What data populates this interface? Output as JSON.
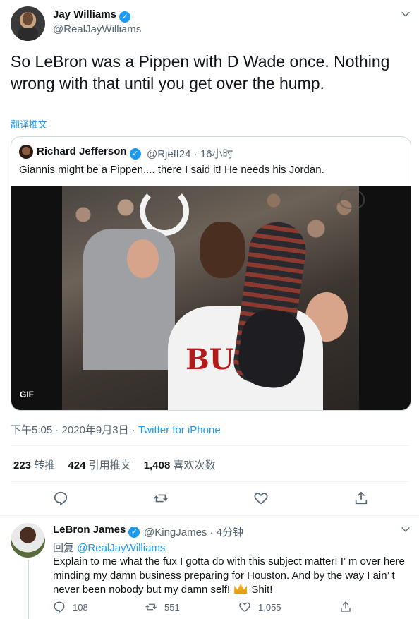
{
  "tweet": {
    "author_name": "Jay Williams",
    "author_handle": "@RealJayWilliams",
    "text": "So LeBron was a Pippen with D Wade once. Nothing wrong with that until you get over the hump.",
    "translate_label": "翻译推文",
    "time": "下午5:05",
    "date": "2020年9月3日",
    "separator": " · ",
    "source": "Twitter for iPhone",
    "stats": {
      "retweets_count": "223",
      "retweets_label": "转推",
      "quotes_count": "424",
      "quotes_label": "引用推文",
      "likes_count": "1,408",
      "likes_label": "喜欢次数"
    }
  },
  "quote": {
    "author_name": "Richard Jefferson",
    "author_handle": "@Rjeff24",
    "time_ago": "16小时",
    "text": "Giannis might be a Pippen.... there I said it! He needs his Jordan.",
    "media_badge": "GIF",
    "jersey_text": "BU"
  },
  "reply": {
    "author_name": "LeBron James",
    "author_handle": "@KingJames",
    "time_ago": "4分钟",
    "reply_prefix": "回复",
    "reply_mention": "@RealJayWilliams",
    "text_before_emoji": "Explain to me what the fux I gotta do with this subject matter! I’ m over here minding my damn business preparing for Houston. And by the way I ain’ t never been nobody but my damn self!",
    "text_after_emoji": "Shit!",
    "reply_count": "108",
    "retweet_count": "551",
    "like_count": "1,055"
  },
  "colors": {
    "accent": "#1d9bf0",
    "text": "#0f1419",
    "muted": "#536471",
    "border": "#cfd9de"
  },
  "icons": [
    "verified-icon",
    "chevron-down-icon",
    "reply-icon",
    "retweet-icon",
    "like-icon",
    "share-icon",
    "crown-emoji"
  ]
}
